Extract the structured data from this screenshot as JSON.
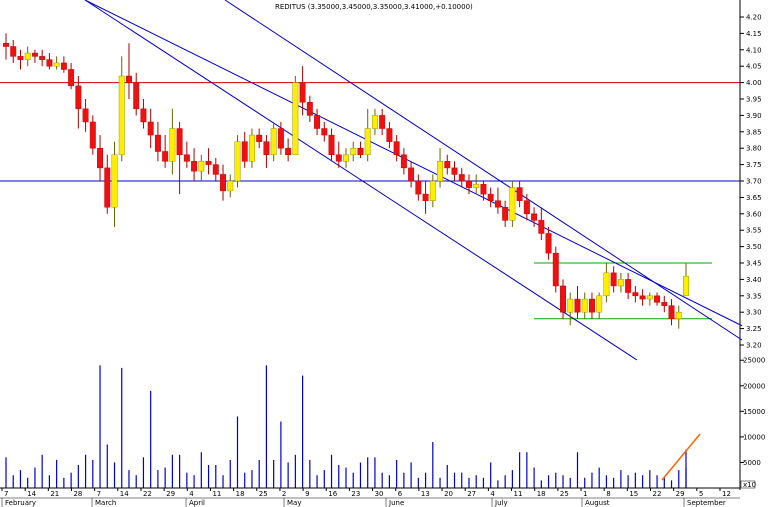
{
  "chart_data": {
    "type": "candlestick",
    "title": "REDITUS (3.35000,3.45000,3.35000,3.41000,+0.10000)",
    "price_axis": {
      "ylim": [
        3.2,
        4.2
      ],
      "ticks": [
        "4.20",
        "4.15",
        "4.10",
        "4.05",
        "4.00",
        "3.95",
        "3.90",
        "3.85",
        "3.80",
        "3.75",
        "3.70",
        "3.65",
        "3.60",
        "3.55",
        "3.50",
        "3.45",
        "3.40",
        "3.35",
        "3.30",
        "3.25",
        "3.20"
      ]
    },
    "volume_axis": {
      "ylim": [
        0,
        27000
      ],
      "ticks": [
        "25000",
        "20000",
        "15000",
        "10000",
        "5000"
      ],
      "unit_label": "x10"
    },
    "month_labels": [
      "February",
      "March",
      "April",
      "May",
      "June",
      "July",
      "August",
      "September"
    ],
    "day_labels": [
      "7",
      "14",
      "21",
      "28",
      "7",
      "14",
      "22",
      "29",
      "4",
      "11",
      "18",
      "25",
      "2",
      "9",
      "16",
      "23",
      "30",
      "6",
      "13",
      "20",
      "27",
      "4",
      "11",
      "18",
      "25",
      "1",
      "8",
      "15",
      "22",
      "29",
      "5",
      "12"
    ],
    "horizontal_levels": [
      {
        "value": 4.0,
        "color": "#cc0000"
      },
      {
        "value": 3.7,
        "color": "#0000cc"
      }
    ],
    "range_lines": [
      {
        "value": 3.45,
        "color": "#00aa00"
      },
      {
        "value": 3.28,
        "color": "#00aa00"
      }
    ],
    "trend_channel": {
      "color": "#0000cc",
      "upper": {
        "from": [
          0.0,
          4.44
        ],
        "to": [
          1.0,
          3.28
        ]
      },
      "lower": {
        "from": [
          0.0,
          4.28
        ],
        "to": [
          0.85,
          3.12
        ]
      }
    },
    "volume_trend_arrow_color": "#ff6600",
    "candles": [
      {
        "o": 4.12,
        "h": 4.15,
        "l": 4.07,
        "c": 4.11
      },
      {
        "o": 4.11,
        "h": 4.13,
        "l": 4.06,
        "c": 4.08
      },
      {
        "o": 4.08,
        "h": 4.1,
        "l": 4.04,
        "c": 4.07
      },
      {
        "o": 4.07,
        "h": 4.11,
        "l": 4.05,
        "c": 4.09
      },
      {
        "o": 4.09,
        "h": 4.1,
        "l": 4.06,
        "c": 4.08
      },
      {
        "o": 4.08,
        "h": 4.1,
        "l": 4.05,
        "c": 4.07
      },
      {
        "o": 4.07,
        "h": 4.09,
        "l": 4.04,
        "c": 4.05
      },
      {
        "o": 4.05,
        "h": 4.08,
        "l": 4.04,
        "c": 4.06
      },
      {
        "o": 4.06,
        "h": 4.08,
        "l": 4.03,
        "c": 4.04
      },
      {
        "o": 4.04,
        "h": 4.06,
        "l": 3.98,
        "c": 3.99
      },
      {
        "o": 3.99,
        "h": 4.02,
        "l": 3.86,
        "c": 3.92
      },
      {
        "o": 3.92,
        "h": 3.95,
        "l": 3.85,
        "c": 3.88
      },
      {
        "o": 3.88,
        "h": 3.9,
        "l": 3.78,
        "c": 3.8
      },
      {
        "o": 3.8,
        "h": 3.84,
        "l": 3.7,
        "c": 3.74
      },
      {
        "o": 3.74,
        "h": 3.78,
        "l": 3.6,
        "c": 3.62
      },
      {
        "o": 3.62,
        "h": 3.82,
        "l": 3.56,
        "c": 3.78
      },
      {
        "o": 3.78,
        "h": 4.08,
        "l": 3.76,
        "c": 4.02
      },
      {
        "o": 4.02,
        "h": 4.12,
        "l": 3.95,
        "c": 4.0
      },
      {
        "o": 4.0,
        "h": 4.03,
        "l": 3.9,
        "c": 3.92
      },
      {
        "o": 3.92,
        "h": 3.95,
        "l": 3.86,
        "c": 3.88
      },
      {
        "o": 3.88,
        "h": 3.92,
        "l": 3.8,
        "c": 3.84
      },
      {
        "o": 3.84,
        "h": 3.88,
        "l": 3.76,
        "c": 3.79
      },
      {
        "o": 3.79,
        "h": 3.84,
        "l": 3.74,
        "c": 3.76
      },
      {
        "o": 3.76,
        "h": 3.92,
        "l": 3.72,
        "c": 3.86
      },
      {
        "o": 3.86,
        "h": 3.88,
        "l": 3.66,
        "c": 3.78
      },
      {
        "o": 3.78,
        "h": 3.82,
        "l": 3.74,
        "c": 3.76
      },
      {
        "o": 3.76,
        "h": 3.8,
        "l": 3.7,
        "c": 3.73
      },
      {
        "o": 3.73,
        "h": 3.78,
        "l": 3.7,
        "c": 3.76
      },
      {
        "o": 3.76,
        "h": 3.8,
        "l": 3.72,
        "c": 3.75
      },
      {
        "o": 3.75,
        "h": 3.77,
        "l": 3.7,
        "c": 3.72
      },
      {
        "o": 3.72,
        "h": 3.75,
        "l": 3.64,
        "c": 3.67
      },
      {
        "o": 3.67,
        "h": 3.72,
        "l": 3.65,
        "c": 3.7
      },
      {
        "o": 3.7,
        "h": 3.84,
        "l": 3.68,
        "c": 3.82
      },
      {
        "o": 3.82,
        "h": 3.85,
        "l": 3.74,
        "c": 3.76
      },
      {
        "o": 3.76,
        "h": 3.86,
        "l": 3.74,
        "c": 3.84
      },
      {
        "o": 3.84,
        "h": 3.86,
        "l": 3.8,
        "c": 3.82
      },
      {
        "o": 3.82,
        "h": 3.84,
        "l": 3.74,
        "c": 3.78
      },
      {
        "o": 3.78,
        "h": 3.88,
        "l": 3.76,
        "c": 3.86
      },
      {
        "o": 3.86,
        "h": 3.88,
        "l": 3.78,
        "c": 3.8
      },
      {
        "o": 3.8,
        "h": 3.83,
        "l": 3.76,
        "c": 3.78
      },
      {
        "o": 3.78,
        "h": 4.02,
        "l": 3.86,
        "c": 4.0
      },
      {
        "o": 4.0,
        "h": 4.05,
        "l": 3.9,
        "c": 3.94
      },
      {
        "o": 3.94,
        "h": 3.96,
        "l": 3.88,
        "c": 3.9
      },
      {
        "o": 3.9,
        "h": 3.92,
        "l": 3.84,
        "c": 3.86
      },
      {
        "o": 3.86,
        "h": 3.88,
        "l": 3.82,
        "c": 3.84
      },
      {
        "o": 3.84,
        "h": 3.86,
        "l": 3.76,
        "c": 3.78
      },
      {
        "o": 3.78,
        "h": 3.82,
        "l": 3.74,
        "c": 3.76
      },
      {
        "o": 3.76,
        "h": 3.8,
        "l": 3.74,
        "c": 3.78
      },
      {
        "o": 3.78,
        "h": 3.82,
        "l": 3.76,
        "c": 3.8
      },
      {
        "o": 3.8,
        "h": 3.82,
        "l": 3.77,
        "c": 3.78
      },
      {
        "o": 3.78,
        "h": 3.92,
        "l": 3.76,
        "c": 3.86
      },
      {
        "o": 3.86,
        "h": 3.92,
        "l": 3.84,
        "c": 3.9
      },
      {
        "o": 3.9,
        "h": 3.92,
        "l": 3.84,
        "c": 3.86
      },
      {
        "o": 3.86,
        "h": 3.88,
        "l": 3.8,
        "c": 3.82
      },
      {
        "o": 3.82,
        "h": 3.84,
        "l": 3.76,
        "c": 3.78
      },
      {
        "o": 3.78,
        "h": 3.8,
        "l": 3.72,
        "c": 3.74
      },
      {
        "o": 3.74,
        "h": 3.76,
        "l": 3.68,
        "c": 3.7
      },
      {
        "o": 3.7,
        "h": 3.72,
        "l": 3.64,
        "c": 3.66
      },
      {
        "o": 3.66,
        "h": 3.7,
        "l": 3.6,
        "c": 3.64
      },
      {
        "o": 3.64,
        "h": 3.72,
        "l": 3.62,
        "c": 3.7
      },
      {
        "o": 3.7,
        "h": 3.8,
        "l": 3.68,
        "c": 3.76
      },
      {
        "o": 3.76,
        "h": 3.78,
        "l": 3.72,
        "c": 3.74
      },
      {
        "o": 3.74,
        "h": 3.76,
        "l": 3.7,
        "c": 3.72
      },
      {
        "o": 3.72,
        "h": 3.74,
        "l": 3.68,
        "c": 3.7
      },
      {
        "o": 3.7,
        "h": 3.72,
        "l": 3.66,
        "c": 3.68
      },
      {
        "o": 3.68,
        "h": 3.72,
        "l": 3.66,
        "c": 3.69
      },
      {
        "o": 3.69,
        "h": 3.7,
        "l": 3.64,
        "c": 3.66
      },
      {
        "o": 3.66,
        "h": 3.68,
        "l": 3.62,
        "c": 3.64
      },
      {
        "o": 3.64,
        "h": 3.68,
        "l": 3.6,
        "c": 3.62
      },
      {
        "o": 3.62,
        "h": 3.64,
        "l": 3.56,
        "c": 3.58
      },
      {
        "o": 3.58,
        "h": 3.7,
        "l": 3.56,
        "c": 3.68
      },
      {
        "o": 3.68,
        "h": 3.7,
        "l": 3.62,
        "c": 3.64
      },
      {
        "o": 3.64,
        "h": 3.66,
        "l": 3.58,
        "c": 3.6
      },
      {
        "o": 3.6,
        "h": 3.62,
        "l": 3.56,
        "c": 3.58
      },
      {
        "o": 3.58,
        "h": 3.62,
        "l": 3.52,
        "c": 3.54
      },
      {
        "o": 3.54,
        "h": 3.56,
        "l": 3.46,
        "c": 3.48
      },
      {
        "o": 3.48,
        "h": 3.5,
        "l": 3.36,
        "c": 3.38
      },
      {
        "o": 3.38,
        "h": 3.4,
        "l": 3.28,
        "c": 3.3
      },
      {
        "o": 3.3,
        "h": 3.36,
        "l": 3.26,
        "c": 3.34
      },
      {
        "o": 3.34,
        "h": 3.38,
        "l": 3.28,
        "c": 3.3
      },
      {
        "o": 3.3,
        "h": 3.36,
        "l": 3.28,
        "c": 3.34
      },
      {
        "o": 3.34,
        "h": 3.36,
        "l": 3.28,
        "c": 3.3
      },
      {
        "o": 3.3,
        "h": 3.36,
        "l": 3.28,
        "c": 3.35
      },
      {
        "o": 3.35,
        "h": 3.45,
        "l": 3.33,
        "c": 3.42
      },
      {
        "o": 3.42,
        "h": 3.44,
        "l": 3.36,
        "c": 3.38
      },
      {
        "o": 3.38,
        "h": 3.42,
        "l": 3.36,
        "c": 3.4
      },
      {
        "o": 3.4,
        "h": 3.42,
        "l": 3.34,
        "c": 3.36
      },
      {
        "o": 3.36,
        "h": 3.38,
        "l": 3.33,
        "c": 3.35
      },
      {
        "o": 3.35,
        "h": 3.37,
        "l": 3.32,
        "c": 3.34
      },
      {
        "o": 3.34,
        "h": 3.36,
        "l": 3.32,
        "c": 3.35
      },
      {
        "o": 3.35,
        "h": 3.36,
        "l": 3.32,
        "c": 3.33
      },
      {
        "o": 3.33,
        "h": 3.35,
        "l": 3.3,
        "c": 3.32
      },
      {
        "o": 3.32,
        "h": 3.34,
        "l": 3.26,
        "c": 3.28
      },
      {
        "o": 3.28,
        "h": 3.32,
        "l": 3.25,
        "c": 3.3
      },
      {
        "o": 3.35,
        "h": 3.45,
        "l": 3.35,
        "c": 3.41
      }
    ],
    "volumes": [
      6000,
      2500,
      3500,
      2000,
      4000,
      6500,
      2500,
      5500,
      2000,
      3000,
      4500,
      6500,
      5500,
      24000,
      8500,
      5000,
      23500,
      3500,
      2500,
      6000,
      19000,
      3500,
      4000,
      6500,
      6500,
      3000,
      2500,
      7000,
      4500,
      4500,
      2500,
      5500,
      14000,
      3000,
      3500,
      5500,
      24000,
      5500,
      13000,
      5000,
      6500,
      22000,
      5500,
      2500,
      3500,
      6500,
      4500,
      4000,
      3000,
      5000,
      6000,
      6000,
      3000,
      2500,
      5500,
      3000,
      5000,
      2000,
      3000,
      9000,
      2000,
      4500,
      3000,
      3000,
      2000,
      2500,
      2000,
      5000,
      1500,
      2500,
      3500,
      7000,
      7000,
      4000,
      1500,
      2500,
      3000,
      2500,
      2000,
      7000,
      2000,
      3000,
      4000,
      2500,
      2000,
      3500,
      2500,
      3000,
      2500,
      3500,
      2500,
      2000,
      1500,
      3500,
      4000,
      7500
    ]
  }
}
